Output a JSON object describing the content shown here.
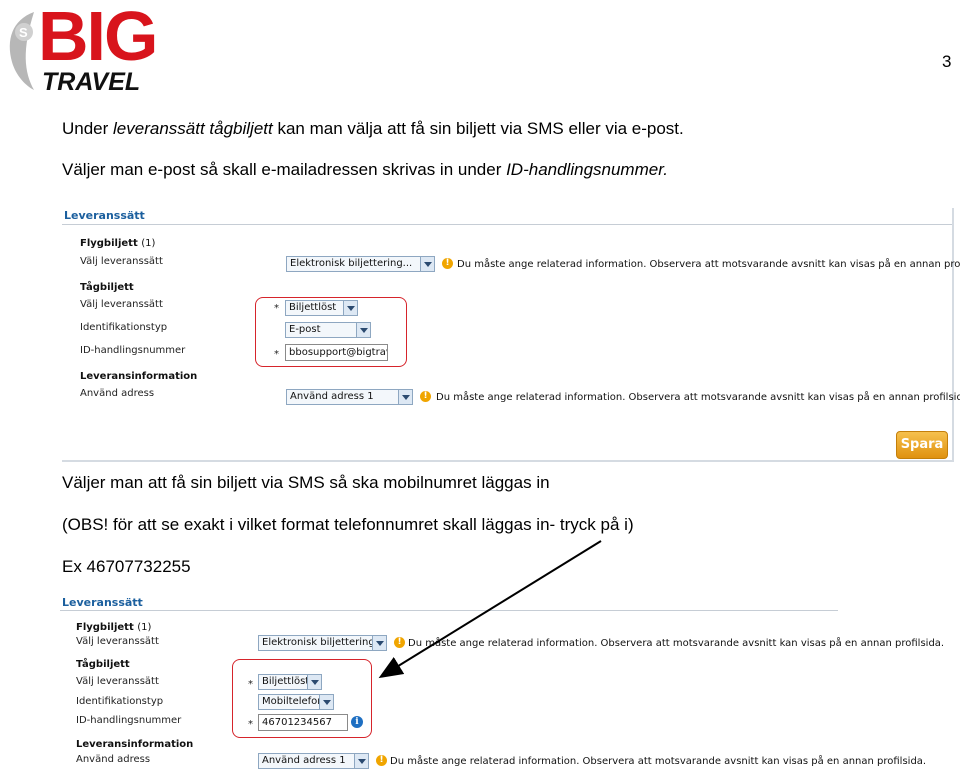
{
  "logo": {
    "big": "BIG",
    "travel": "TRAVEL"
  },
  "page_number": "3",
  "intro": {
    "line1_a": "Under ",
    "line1_b": "leveranssätt tågbiljett",
    "line1_c": " kan man välja att få sin biljett via SMS eller via e-post.",
    "line2_a": "Väljer man e-post så skall e-mailadressen skrivas in under ",
    "line2_b": "ID-handlingsnummer."
  },
  "sms": {
    "line1": "Väljer man att få sin biljett via SMS så ska mobilnumret läggas in",
    "line2": "(OBS! för att se exakt i vilket format telefonnumret skall läggas in- tryck på i)",
    "example": "Ex 46707732255"
  },
  "form1": {
    "title": "Leveranssätt",
    "flight_heading": "Flygbiljett",
    "flight_count": "(1)",
    "flight_method_label": "Välj leveranssätt",
    "flight_method_value": "Elektronisk biljettering...",
    "warning_text": "Du måste ange relaterad information. Observera att motsvarande avsnitt kan visas på en annan profilsida.",
    "train_heading": "Tågbiljett",
    "train_method_label": "Välj leveranssätt",
    "train_method_value": "Biljettlöst",
    "id_type_label": "Identifikationstyp",
    "id_type_value": "E-post",
    "id_number_label": "ID-handlingsnummer",
    "id_number_value": "bbosupport@bigtrav",
    "delivery_heading": "Leveransinformation",
    "address_label": "Använd adress",
    "address_value": "Använd adress 1",
    "required_mark": "*",
    "save_label": "Spara"
  },
  "form2": {
    "title": "Leveranssätt",
    "flight_heading": "Flygbiljett",
    "flight_count": "(1)",
    "flight_method_label": "Välj leveranssätt",
    "flight_method_value": "Elektronisk biljettering...",
    "warning_text": "Du måste ange relaterad information. Observera att motsvarande avsnitt kan visas på en annan profilsida.",
    "train_heading": "Tågbiljett",
    "train_method_label": "Välj leveranssätt",
    "train_method_value": "Biljettlöst",
    "id_type_label": "Identifikationstyp",
    "id_type_value": "Mobiltelefon",
    "id_number_label": "ID-handlingsnummer",
    "id_number_value": "46701234567",
    "delivery_heading": "Leveransinformation",
    "address_label": "Använd adress",
    "address_value": "Använd adress 1",
    "required_mark": "*"
  },
  "colors": {
    "brand_red": "#d8141c",
    "link_blue": "#1b5f9e",
    "highlight_red": "#d6242b",
    "save_orange": "#e0920f"
  },
  "icons": {
    "warning": "warning-icon",
    "info": "info-icon",
    "dropdown": "chevron-down-icon"
  }
}
